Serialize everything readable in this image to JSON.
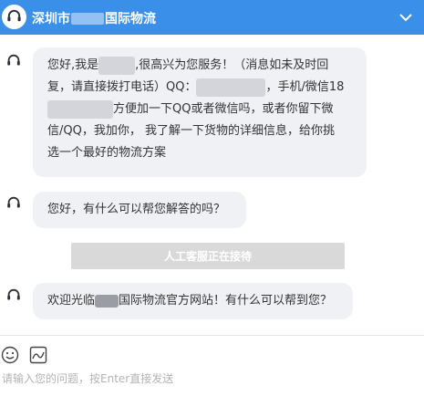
{
  "header": {
    "title_prefix": "深圳市",
    "title_suffix": "国际物流"
  },
  "messages": [
    {
      "line1_a": "您好,我是",
      "line1_b": ",很高兴为您服务！（消息如未及时回",
      "line2_a": "复，请直接拨打电话）QQ：",
      "line2_b": "，手机/微信18",
      "line3_b": "方便加一下QQ或者微信吗，或者你留下微",
      "line4": "信/QQ，我加你， 我了解一下货物的详细信息，给你挑",
      "line5": "选一个最好的物流方案"
    },
    {
      "text": "您好，有什么可以帮您解答的吗？"
    },
    {
      "text_a": "欢迎光临",
      "text_b": "国际物流官方网站！有什么可以帮到您？"
    }
  ],
  "service_status": "人工客服正在接待",
  "input": {
    "placeholder": "请输入您的问题，按Enter直接发送"
  },
  "icons": {
    "header_avatar": "headset-icon",
    "agent": "headset-icon",
    "collapse": "chevron-down-icon",
    "emoji": "emoji-icon",
    "image": "image-icon"
  },
  "colors": {
    "header_bg": "#3a8fe8",
    "bubble_bg": "#f0f1f5",
    "status_bar_bg": "#d9d9d9"
  }
}
